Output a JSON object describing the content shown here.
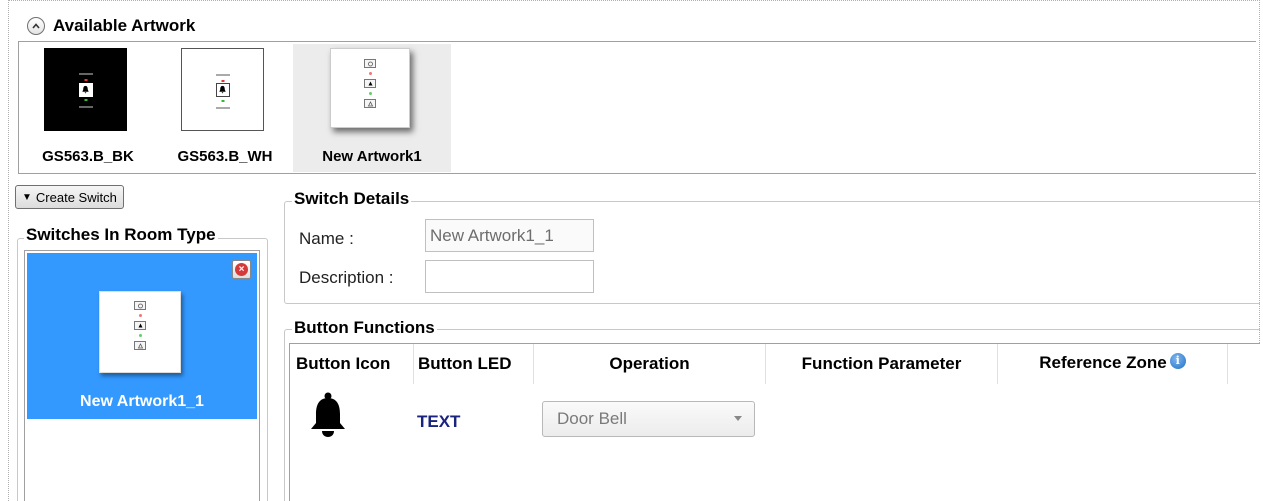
{
  "available_artwork": {
    "title": "Available Artwork",
    "items": [
      {
        "label": "GS563.B_BK",
        "theme": "black",
        "selected": false
      },
      {
        "label": "GS563.B_WH",
        "theme": "white",
        "selected": false
      },
      {
        "label": "New Artwork1",
        "theme": "white-shadow",
        "selected": true
      }
    ]
  },
  "create_switch": {
    "label": "Create Switch"
  },
  "switches_in_room_type": {
    "title": "Switches In Room Type",
    "items": [
      {
        "label": "New Artwork1_1",
        "selected": true
      }
    ]
  },
  "switch_details": {
    "title": "Switch Details",
    "name_label": "Name :",
    "name_value": "New Artwork1_1",
    "description_label": "Description :",
    "description_value": ""
  },
  "button_functions": {
    "title": "Button Functions",
    "columns": [
      "Button Icon",
      "Button LED",
      "Operation",
      "Function Parameter",
      "Reference Zone"
    ],
    "rows": [
      {
        "icon": "bell-icon",
        "led": "TEXT",
        "operation": "Door Bell"
      }
    ]
  },
  "colors": {
    "selection": "#3399ff",
    "led_text": "#1a237e",
    "delete": "#d43a3a"
  }
}
